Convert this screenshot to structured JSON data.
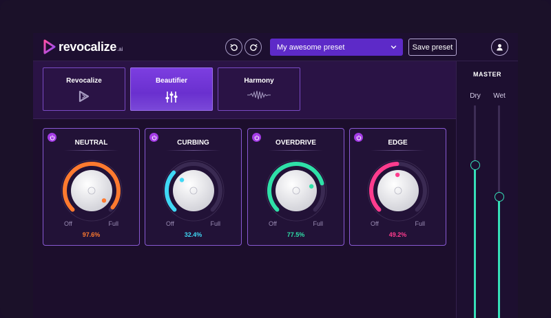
{
  "header": {
    "logo_text": "revocalize",
    "logo_sub": ".ai",
    "undo_icon": "undo-icon",
    "redo_icon": "redo-icon",
    "preset_value": "My awesome preset",
    "save_label": "Save preset",
    "user_icon": "user-icon"
  },
  "tabs": [
    {
      "label": "Revocalize",
      "icon": "play-logo-icon",
      "active": false
    },
    {
      "label": "Beautifier",
      "icon": "sliders-icon",
      "active": true
    },
    {
      "label": "Harmony",
      "icon": "waveform-icon",
      "active": false
    }
  ],
  "effects": [
    {
      "name": "NEUTRAL",
      "value_text": "97.6%",
      "level": 0.976,
      "color": "#ff7a2f",
      "off": "Off",
      "full": "Full",
      "enabled": true
    },
    {
      "name": "CURBING",
      "value_text": "32.4%",
      "level": 0.324,
      "color": "#3fd8f5",
      "off": "Off",
      "full": "Full",
      "enabled": true
    },
    {
      "name": "OVERDRIVE",
      "value_text": "77.5%",
      "level": 0.775,
      "color": "#2fe0a8",
      "off": "Off",
      "full": "Full",
      "enabled": true
    },
    {
      "name": "EDGE",
      "value_text": "49.2%",
      "level": 0.492,
      "color": "#ff3c8e",
      "off": "Off",
      "full": "Full",
      "enabled": true
    }
  ],
  "master": {
    "title": "MASTER",
    "dry_label": "Dry",
    "wet_label": "Wet",
    "dry_level": 0.72,
    "wet_level": 0.57,
    "accent": "#36e0b8"
  }
}
